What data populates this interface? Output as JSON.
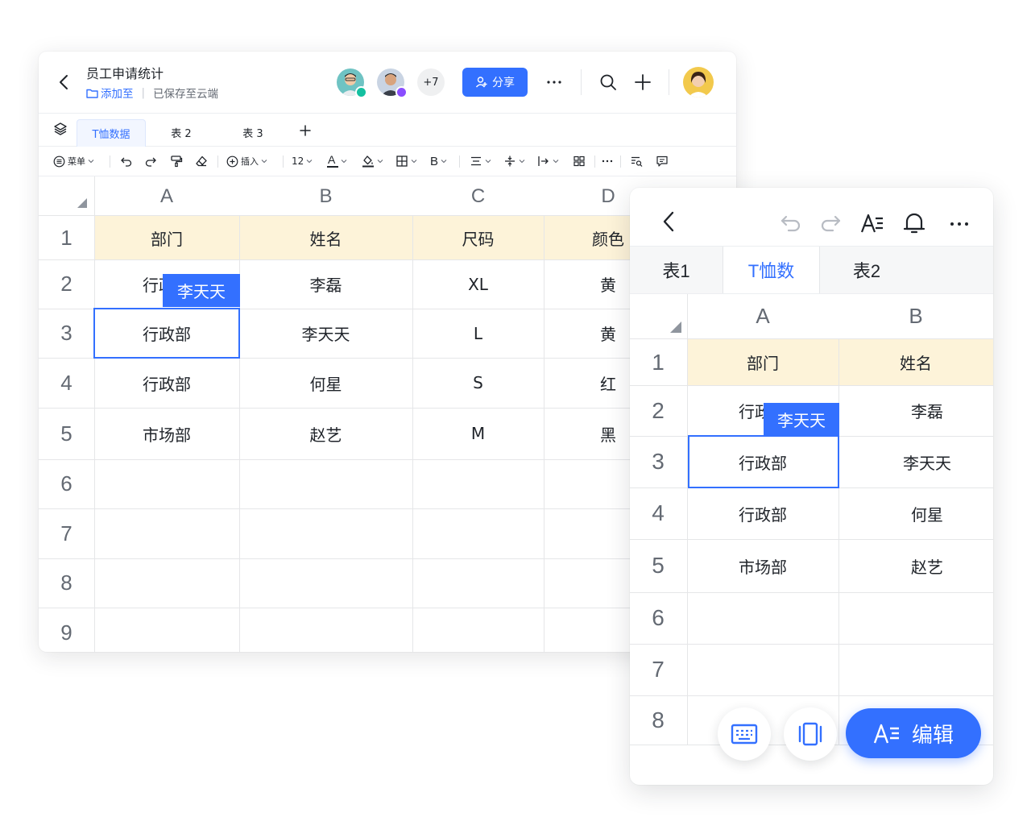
{
  "desktop": {
    "header": {
      "title": "员工申请统计",
      "add_to_label": "添加至",
      "save_status": "已保存至云端",
      "collaborators_more": "+7",
      "share_label": "分享",
      "icons": [
        "back-icon",
        "folder-icon",
        "more-icon",
        "search-icon",
        "plus-icon"
      ]
    },
    "tabs": [
      {
        "label": "T恤数据",
        "active": true
      },
      {
        "label": "表 2",
        "active": false
      },
      {
        "label": "表 3",
        "active": false
      }
    ],
    "toolbar": {
      "menu_label": "菜单",
      "insert_label": "插入",
      "font_size": "12",
      "text_color_letter": "A",
      "bold_letter": "B"
    },
    "columns": [
      "A",
      "B",
      "C",
      "D"
    ],
    "rows": [
      "1",
      "2",
      "3",
      "4",
      "5",
      "6",
      "7",
      "8",
      "9"
    ],
    "cells": [
      [
        "部门",
        "姓名",
        "尺码",
        "颜色"
      ],
      [
        "行政部",
        "李磊",
        "XL",
        "黄"
      ],
      [
        "行政部",
        "李天天",
        "L",
        "黄"
      ],
      [
        "行政部",
        "何星",
        "S",
        "红"
      ],
      [
        "市场部",
        "赵艺",
        "M",
        "黑"
      ]
    ],
    "collaborator_tag": "李天天"
  },
  "mobile": {
    "tabs": [
      {
        "label": "表1",
        "active": false
      },
      {
        "label": "T恤数",
        "active": true
      },
      {
        "label": "表2",
        "active": false
      }
    ],
    "columns": [
      "A",
      "B"
    ],
    "rows": [
      "1",
      "2",
      "3",
      "4",
      "5",
      "6",
      "7",
      "8"
    ],
    "cells": [
      [
        "部门",
        "姓名"
      ],
      [
        "行政部",
        "李磊"
      ],
      [
        "行政部",
        "李天天"
      ],
      [
        "行政部",
        "何星"
      ],
      [
        "市场部",
        "赵艺"
      ]
    ],
    "collaborator_tag": "李天天",
    "edit_label": "编辑"
  },
  "colors": {
    "accent": "#3370ff",
    "header_row_fill": "#fdf3d9",
    "grid_line": "#e5e6e8"
  }
}
